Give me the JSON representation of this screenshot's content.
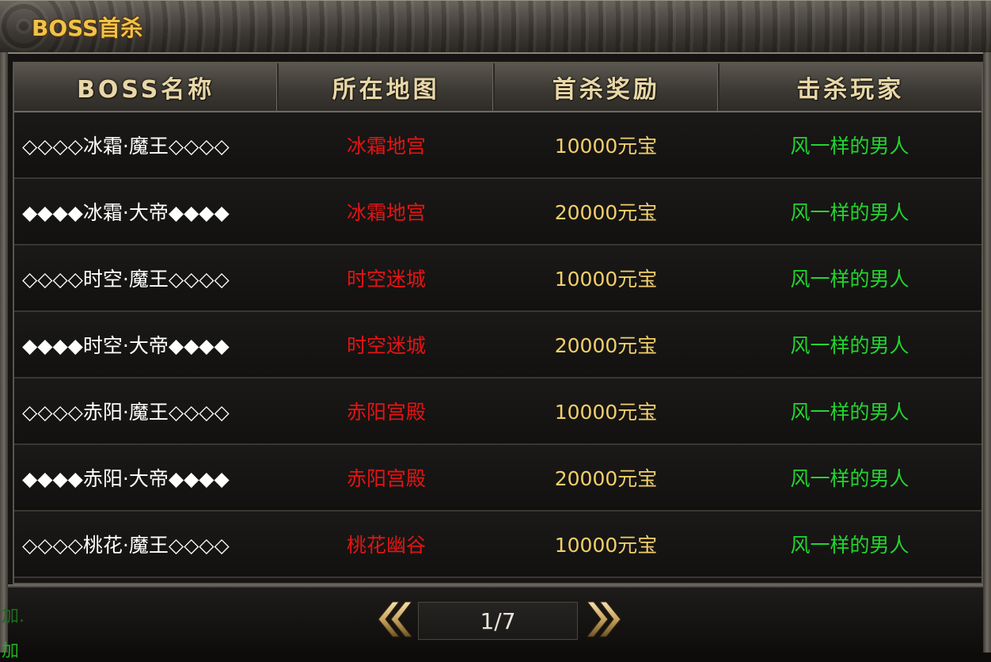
{
  "window": {
    "title": "BOSS首杀"
  },
  "table": {
    "headers": [
      "BOSS名称",
      "所在地图",
      "首杀奖励",
      "击杀玩家"
    ],
    "rows": [
      {
        "name": "◇◇◇◇冰霜·魔王◇◇◇◇",
        "map": "冰霜地宫",
        "reward": "10000元宝",
        "player": "风一样的男人"
      },
      {
        "name": "◆◆◆◆冰霜·大帝◆◆◆◆",
        "map": "冰霜地宫",
        "reward": "20000元宝",
        "player": "风一样的男人"
      },
      {
        "name": "◇◇◇◇时空·魔王◇◇◇◇",
        "map": "时空迷城",
        "reward": "10000元宝",
        "player": "风一样的男人"
      },
      {
        "name": "◆◆◆◆时空·大帝◆◆◆◆",
        "map": "时空迷城",
        "reward": "20000元宝",
        "player": "风一样的男人"
      },
      {
        "name": "◇◇◇◇赤阳·魔王◇◇◇◇",
        "map": "赤阳宫殿",
        "reward": "10000元宝",
        "player": "风一样的男人"
      },
      {
        "name": "◆◆◆◆赤阳·大帝◆◆◆◆",
        "map": "赤阳宫殿",
        "reward": "20000元宝",
        "player": "风一样的男人"
      },
      {
        "name": "◇◇◇◇桃花·魔王◇◇◇◇",
        "map": "桃花幽谷",
        "reward": "10000元宝",
        "player": "风一样的男人"
      }
    ]
  },
  "pager": {
    "page_label": "1/7",
    "prev_icon": "double-chevron-left-icon",
    "next_icon": "double-chevron-right-icon"
  },
  "side": {
    "text1": "加.",
    "text2": "加"
  },
  "colors": {
    "map": "#e31414",
    "reward": "#f2cf6a",
    "player": "#22d62e",
    "title": "#f0c24a"
  }
}
